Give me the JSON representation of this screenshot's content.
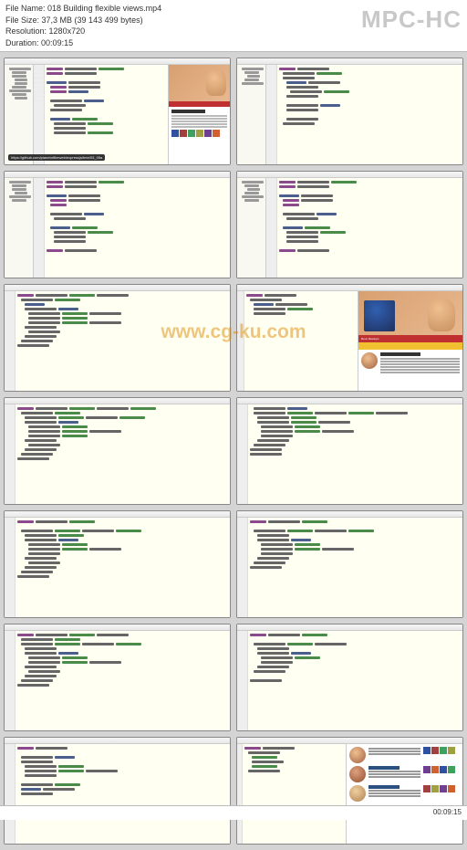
{
  "app": {
    "title_label": "MPC-HC"
  },
  "info": {
    "filename_label": "File Name:",
    "filename": "018 Building flexible views.mp4",
    "filesize_label": "File Size:",
    "filesize": "37,3 MB (39 143 499 bytes)",
    "resolution_label": "Resolution:",
    "resolution": "1280x720",
    "duration_label": "Duration:",
    "duration": "00:09:15"
  },
  "url_tooltip": "https://github.com/planetoftheweb/expressjs/tree/03_05a",
  "watermark": "www.cg-ku.com",
  "preview1": {
    "sidebar_title": "Artwork on display",
    "sidebar_text": "While you attend the conference check out the artwork"
  },
  "preview6": {
    "nav_label": "Roux Meetups",
    "menu_home": "Home",
    "menu_speakers": "Speakers",
    "band_label": "",
    "card_title": "Art in Full Bloom",
    "card_text": "Drawing and painting flowers may seem like a first-year art student's assignment. But Lorenzo Garcia brings depth, shadows, light, form and color"
  },
  "preview14": {
    "row1_title": "Deep Sea Wonders",
    "row2_title": "The Art of Abstract"
  },
  "code_sample": {
    "lines": [
      "var express = require('express');",
      "var router = express.Router();",
      "",
      "router.get('/', function(req, res) {",
      "  var data = req.app.get('appData');",
      "  var pagePhotos = [];",
      "",
      "  data.speakers.forEach(function(item) {",
      "    pagePhotos = pagePhotos.concat(item.artwork);",
      "  });",
      "",
      "  res.render('index', {",
      "    pageTitle: 'Home',",
      "    artwork: pagePhotos,",
      "    pageID: 'home'",
      "  });",
      "});",
      "",
      "module.exports = router;"
    ]
  }
}
